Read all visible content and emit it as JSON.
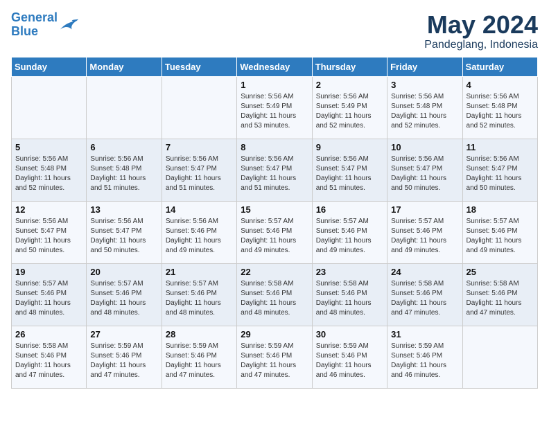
{
  "logo": {
    "text_general": "General",
    "text_blue": "Blue"
  },
  "title": "May 2024",
  "subtitle": "Pandeglang, Indonesia",
  "days_of_week": [
    "Sunday",
    "Monday",
    "Tuesday",
    "Wednesday",
    "Thursday",
    "Friday",
    "Saturday"
  ],
  "weeks": [
    [
      {
        "day": "",
        "info": ""
      },
      {
        "day": "",
        "info": ""
      },
      {
        "day": "",
        "info": ""
      },
      {
        "day": "1",
        "info": "Sunrise: 5:56 AM\nSunset: 5:49 PM\nDaylight: 11 hours\nand 53 minutes."
      },
      {
        "day": "2",
        "info": "Sunrise: 5:56 AM\nSunset: 5:49 PM\nDaylight: 11 hours\nand 52 minutes."
      },
      {
        "day": "3",
        "info": "Sunrise: 5:56 AM\nSunset: 5:48 PM\nDaylight: 11 hours\nand 52 minutes."
      },
      {
        "day": "4",
        "info": "Sunrise: 5:56 AM\nSunset: 5:48 PM\nDaylight: 11 hours\nand 52 minutes."
      }
    ],
    [
      {
        "day": "5",
        "info": "Sunrise: 5:56 AM\nSunset: 5:48 PM\nDaylight: 11 hours\nand 52 minutes."
      },
      {
        "day": "6",
        "info": "Sunrise: 5:56 AM\nSunset: 5:48 PM\nDaylight: 11 hours\nand 51 minutes."
      },
      {
        "day": "7",
        "info": "Sunrise: 5:56 AM\nSunset: 5:47 PM\nDaylight: 11 hours\nand 51 minutes."
      },
      {
        "day": "8",
        "info": "Sunrise: 5:56 AM\nSunset: 5:47 PM\nDaylight: 11 hours\nand 51 minutes."
      },
      {
        "day": "9",
        "info": "Sunrise: 5:56 AM\nSunset: 5:47 PM\nDaylight: 11 hours\nand 51 minutes."
      },
      {
        "day": "10",
        "info": "Sunrise: 5:56 AM\nSunset: 5:47 PM\nDaylight: 11 hours\nand 50 minutes."
      },
      {
        "day": "11",
        "info": "Sunrise: 5:56 AM\nSunset: 5:47 PM\nDaylight: 11 hours\nand 50 minutes."
      }
    ],
    [
      {
        "day": "12",
        "info": "Sunrise: 5:56 AM\nSunset: 5:47 PM\nDaylight: 11 hours\nand 50 minutes."
      },
      {
        "day": "13",
        "info": "Sunrise: 5:56 AM\nSunset: 5:47 PM\nDaylight: 11 hours\nand 50 minutes."
      },
      {
        "day": "14",
        "info": "Sunrise: 5:56 AM\nSunset: 5:46 PM\nDaylight: 11 hours\nand 49 minutes."
      },
      {
        "day": "15",
        "info": "Sunrise: 5:57 AM\nSunset: 5:46 PM\nDaylight: 11 hours\nand 49 minutes."
      },
      {
        "day": "16",
        "info": "Sunrise: 5:57 AM\nSunset: 5:46 PM\nDaylight: 11 hours\nand 49 minutes."
      },
      {
        "day": "17",
        "info": "Sunrise: 5:57 AM\nSunset: 5:46 PM\nDaylight: 11 hours\nand 49 minutes."
      },
      {
        "day": "18",
        "info": "Sunrise: 5:57 AM\nSunset: 5:46 PM\nDaylight: 11 hours\nand 49 minutes."
      }
    ],
    [
      {
        "day": "19",
        "info": "Sunrise: 5:57 AM\nSunset: 5:46 PM\nDaylight: 11 hours\nand 48 minutes."
      },
      {
        "day": "20",
        "info": "Sunrise: 5:57 AM\nSunset: 5:46 PM\nDaylight: 11 hours\nand 48 minutes."
      },
      {
        "day": "21",
        "info": "Sunrise: 5:57 AM\nSunset: 5:46 PM\nDaylight: 11 hours\nand 48 minutes."
      },
      {
        "day": "22",
        "info": "Sunrise: 5:58 AM\nSunset: 5:46 PM\nDaylight: 11 hours\nand 48 minutes."
      },
      {
        "day": "23",
        "info": "Sunrise: 5:58 AM\nSunset: 5:46 PM\nDaylight: 11 hours\nand 48 minutes."
      },
      {
        "day": "24",
        "info": "Sunrise: 5:58 AM\nSunset: 5:46 PM\nDaylight: 11 hours\nand 47 minutes."
      },
      {
        "day": "25",
        "info": "Sunrise: 5:58 AM\nSunset: 5:46 PM\nDaylight: 11 hours\nand 47 minutes."
      }
    ],
    [
      {
        "day": "26",
        "info": "Sunrise: 5:58 AM\nSunset: 5:46 PM\nDaylight: 11 hours\nand 47 minutes."
      },
      {
        "day": "27",
        "info": "Sunrise: 5:59 AM\nSunset: 5:46 PM\nDaylight: 11 hours\nand 47 minutes."
      },
      {
        "day": "28",
        "info": "Sunrise: 5:59 AM\nSunset: 5:46 PM\nDaylight: 11 hours\nand 47 minutes."
      },
      {
        "day": "29",
        "info": "Sunrise: 5:59 AM\nSunset: 5:46 PM\nDaylight: 11 hours\nand 47 minutes."
      },
      {
        "day": "30",
        "info": "Sunrise: 5:59 AM\nSunset: 5:46 PM\nDaylight: 11 hours\nand 46 minutes."
      },
      {
        "day": "31",
        "info": "Sunrise: 5:59 AM\nSunset: 5:46 PM\nDaylight: 11 hours\nand 46 minutes."
      },
      {
        "day": "",
        "info": ""
      }
    ]
  ]
}
